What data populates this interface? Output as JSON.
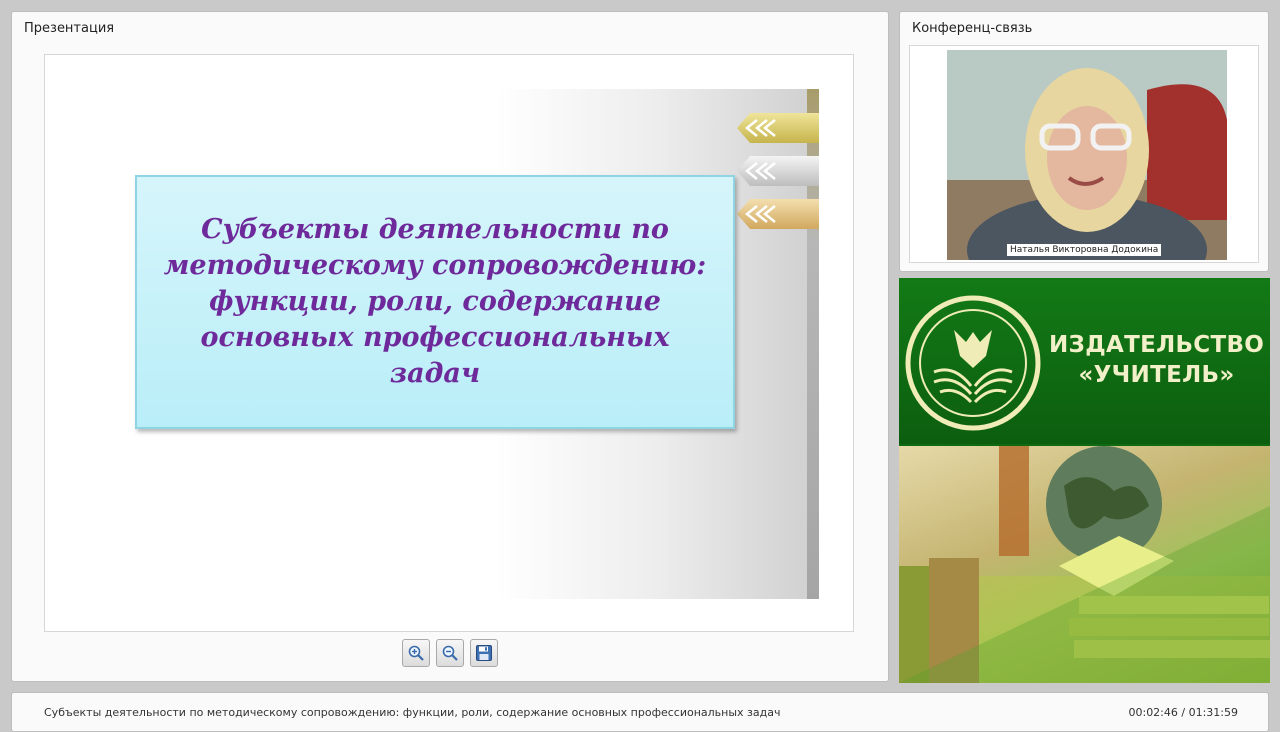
{
  "presentation": {
    "panel_title": "Презентация",
    "slide_title": "Субъекты деятельности по методическому сопровождению: функции, роли, содержание основных профессиональных задач"
  },
  "toolbar": {
    "zoom_in": "zoom-in-icon",
    "zoom_out": "zoom-out-icon",
    "save": "save-icon"
  },
  "conference": {
    "panel_title": "Конференц-связь",
    "speaker_name": "Наталья Викторовна Додокина"
  },
  "banner": {
    "publisher_line1": "ИЗДАТЕЛЬСТВО",
    "publisher_line2": "«УЧИТЕЛЬ»"
  },
  "footer": {
    "title": "Субъекты деятельности по методическому сопровождению: функции, роли, содержание основных профессиональных задач",
    "time": "00:02:46 / 01:31:59"
  },
  "colors": {
    "slide_title": "#6e2a9a",
    "banner_green": "#137a16"
  }
}
